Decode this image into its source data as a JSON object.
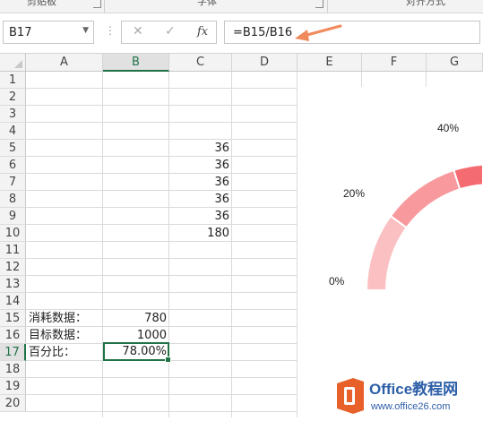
{
  "ribbon": {
    "groups": [
      "剪贴板",
      "字体",
      "对齐方式"
    ]
  },
  "formula_bar": {
    "name_box": "B17",
    "formula": "=B15/B16",
    "cancel_icon": "close-icon",
    "enter_icon": "check-icon",
    "fx_label": "fx"
  },
  "columns": [
    "A",
    "B",
    "C",
    "D",
    "E",
    "F",
    "G"
  ],
  "rows": [
    "1",
    "2",
    "3",
    "4",
    "5",
    "6",
    "7",
    "8",
    "9",
    "10",
    "11",
    "12",
    "13",
    "14",
    "15",
    "16",
    "17",
    "18",
    "19",
    "20"
  ],
  "cells": {
    "C5": "36",
    "C6": "36",
    "C7": "36",
    "C8": "36",
    "C9": "36",
    "C10": "180",
    "A15": "消耗数据：",
    "B15": "780",
    "A16": "目标数据：",
    "B16": "1000",
    "A17": "百分比：",
    "B17": "78.00%"
  },
  "selected_cell": "B17",
  "chart": {
    "labels": [
      "0%",
      "20%",
      "40%"
    ],
    "colors": [
      "#fbc0c2",
      "#f8999d",
      "#f46c72"
    ]
  },
  "watermark": {
    "brand_main": "Office教程网",
    "brand_url": "www.office26.com",
    "brand_color": "#e8612b",
    "text_color": "#2e5fa8"
  }
}
